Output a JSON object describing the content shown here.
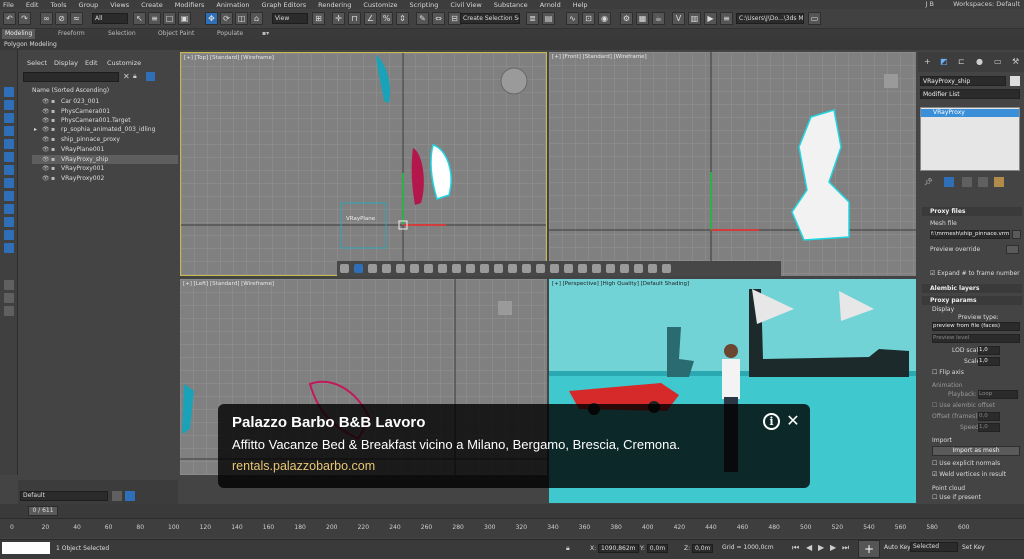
{
  "menu": [
    "File",
    "Edit",
    "Tools",
    "Group",
    "Views",
    "Create",
    "Modifiers",
    "Animation",
    "Graph Editors",
    "Rendering",
    "Customize",
    "Scripting",
    "Civil View",
    "Substance",
    "Arnold",
    "Help"
  ],
  "user": "J B",
  "workspaces": "Workspaces: Default",
  "main_toolbar": {
    "filter": "All",
    "view": "View",
    "selection_set": "Create Selection Se",
    "path": "C:\\Users\\J\\Do...\\3ds Max 202"
  },
  "ribbon_tabs": [
    "Modeling",
    "Freeform",
    "Selection",
    "Object Paint",
    "Populate"
  ],
  "ribbon_sub": "Polygon Modeling",
  "scene_explorer": {
    "menus": [
      "Select",
      "Display",
      "Edit",
      "Customize"
    ],
    "header": "Name (Sorted Ascending)",
    "items": [
      {
        "name": "Car 023_001",
        "selected": false
      },
      {
        "name": "PhysCamera001",
        "selected": false
      },
      {
        "name": "PhysCamera001.Target",
        "selected": false
      },
      {
        "name": "rp_sophia_animated_003_idling",
        "selected": false
      },
      {
        "name": "ship_pinnace_proxy",
        "selected": false
      },
      {
        "name": "VRayPlane001",
        "selected": false
      },
      {
        "name": "VRayProxy_ship",
        "selected": true
      },
      {
        "name": "VRayProxy001",
        "selected": false
      },
      {
        "name": "VRayProxy002",
        "selected": false
      }
    ],
    "layer_dropdown": "Default"
  },
  "viewports": {
    "top": "[+] [Top] [Standard] [Wireframe]",
    "front": "[+] [Front] [Standard] [Wireframe]",
    "left": "[+] [Left] [Standard] [Wireframe]",
    "perspective": "[+] [Perspective] [High Quality] [Default Shading]",
    "vrayplane_label": "VRayPlane"
  },
  "command_panel": {
    "object_name": "VRayProxy_ship",
    "modifier_list": "Modifier List",
    "stack_item": "VRayProxy",
    "proxy_files": "Proxy files",
    "mesh_file_label": "Mesh file",
    "mesh_file_value": "f:\\mrmesh\\ship_pinnace.vrmesh",
    "preview_override": "Preview override",
    "expand_frame": "Expand # to frame number",
    "alembic_layers": "Alembic layers",
    "proxy_params": "Proxy params",
    "display": "Display",
    "preview_type_label": "Preview type:",
    "preview_type_value": "preview from file (faces)",
    "preview_level": "Preview level",
    "lod_scale_label": "LOD scale:",
    "lod_scale": "1,0",
    "scale_label": "Scale:",
    "scale": "1,0",
    "flip_axis": "Flip axis",
    "animation": "Animation",
    "playback_label": "Playback:",
    "playback": "Loop",
    "use_alembic_offset": "Use alembic offset",
    "offset_label": "Offset (frames):",
    "offset": "0,0",
    "speed_label": "Speed:",
    "speed": "1,0",
    "import": "Import",
    "import_mesh": "Import as mesh",
    "use_explicit_normals": "Use explicit normals",
    "weld_vertices": "Weld vertices in result",
    "point_cloud": "Point cloud",
    "use_if_present": "Use if present"
  },
  "timeline": {
    "slider": "0 / 611",
    "ticks": [
      "0",
      "20",
      "40",
      "60",
      "80",
      "100",
      "120",
      "140",
      "160",
      "180",
      "200",
      "220",
      "240",
      "260",
      "280",
      "300",
      "320",
      "340",
      "360",
      "380",
      "400",
      "420",
      "440",
      "460",
      "480",
      "500",
      "520",
      "540",
      "560",
      "580",
      "600"
    ]
  },
  "status": {
    "selection": "1 Object Selected",
    "x": "1090,862m",
    "y": "0,0m",
    "z": "0,0m",
    "grid": "Grid = 1000,0cm",
    "auto_key": "Auto Key",
    "selected": "Selected",
    "set_key": "Set Key"
  },
  "ad": {
    "title": "Palazzo Barbo B&B Lavoro",
    "description": "Affitto Vacanze Bed & Breakfast vicino a Milano, Bergamo, Brescia, Cremona.",
    "url": "rentals.palazzobarbo.com",
    "info_glyph": "i",
    "close_glyph": "✕"
  }
}
